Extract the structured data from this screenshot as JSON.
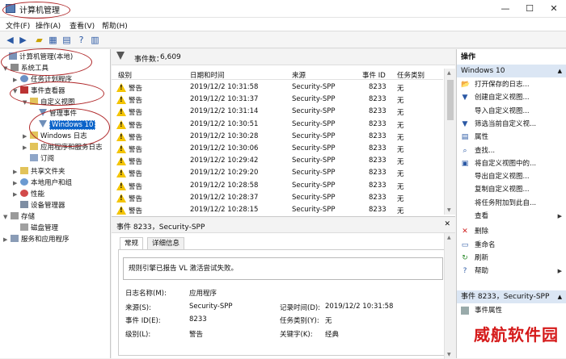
{
  "window": {
    "title": "计算机管理",
    "minimize": "—",
    "maximize": "☐",
    "close": "✕"
  },
  "menu": [
    "文件(F)",
    "操作(A)",
    "查看(V)",
    "帮助(H)"
  ],
  "tree": {
    "root": "计算机管理(本地)",
    "system_tools": "系统工具",
    "task_scheduler": "任务计划程序",
    "event_viewer": "事件查看器",
    "custom_views": "自定义视图",
    "admin_events": "管理事件",
    "windows10": "Windows 10",
    "windows_logs": "Windows 日志",
    "apps_logs": "应用程序和服务日志",
    "subscriptions": "订阅",
    "shared_folders": "共享文件夹",
    "local_users": "本地用户和组",
    "performance": "性能",
    "device_manager": "设备管理器",
    "storage": "存储",
    "disk_management": "磁盘管理",
    "services_apps": "服务和应用程序"
  },
  "events": {
    "header_label": "事件数：",
    "count": "6,609",
    "columns": [
      "级别",
      "日期和时间",
      "来源",
      "事件 ID",
      "任务类别"
    ],
    "rows": [
      {
        "level": "警告",
        "datetime": "2019/12/2 10:31:58",
        "source": "Security-SPP",
        "id": "8233",
        "category": "无"
      },
      {
        "level": "警告",
        "datetime": "2019/12/2 10:31:37",
        "source": "Security-SPP",
        "id": "8233",
        "category": "无"
      },
      {
        "level": "警告",
        "datetime": "2019/12/2 10:31:14",
        "source": "Security-SPP",
        "id": "8233",
        "category": "无"
      },
      {
        "level": "警告",
        "datetime": "2019/12/2 10:30:51",
        "source": "Security-SPP",
        "id": "8233",
        "category": "无"
      },
      {
        "level": "警告",
        "datetime": "2019/12/2 10:30:28",
        "source": "Security-SPP",
        "id": "8233",
        "category": "无"
      },
      {
        "level": "警告",
        "datetime": "2019/12/2 10:30:06",
        "source": "Security-SPP",
        "id": "8233",
        "category": "无"
      },
      {
        "level": "警告",
        "datetime": "2019/12/2 10:29:42",
        "source": "Security-SPP",
        "id": "8233",
        "category": "无"
      },
      {
        "level": "警告",
        "datetime": "2019/12/2 10:29:20",
        "source": "Security-SPP",
        "id": "8233",
        "category": "无"
      },
      {
        "level": "警告",
        "datetime": "2019/12/2 10:28:58",
        "source": "Security-SPP",
        "id": "8233",
        "category": "无"
      },
      {
        "level": "警告",
        "datetime": "2019/12/2 10:28:37",
        "source": "Security-SPP",
        "id": "8233",
        "category": "无"
      },
      {
        "level": "警告",
        "datetime": "2019/12/2 10:28:15",
        "source": "Security-SPP",
        "id": "8233",
        "category": "无"
      }
    ]
  },
  "detail": {
    "title": "事件 8233，Security-SPP",
    "close": "✕",
    "tab_general": "常规",
    "tab_details": "详细信息",
    "message": "规则引擎已报告 VL 激活尝试失败。",
    "log_name_label": "日志名称(M):",
    "log_name": "应用程序",
    "source_label": "来源(S):",
    "source": "Security-SPP",
    "logged_label": "记录时间(D):",
    "logged": "2019/12/2 10:31:58",
    "event_id_label": "事件 ID(E):",
    "event_id": "8233",
    "task_label": "任务类别(Y):",
    "task": "无",
    "level_label": "级别(L):",
    "level": "警告",
    "keywords_label": "关键字(K):",
    "keywords": "经典"
  },
  "actions": {
    "header": "操作",
    "section1": "Windows 10",
    "items": [
      {
        "label": "打开保存的日志...",
        "icon": "open-log-icon",
        "glyph": "📂"
      },
      {
        "label": "创建自定义视图...",
        "icon": "filter-icon",
        "glyph": "▼"
      },
      {
        "label": "导入自定义视图...",
        "icon": "import-icon",
        "glyph": ""
      },
      {
        "label": "筛选当前自定义视...",
        "icon": "filter-icon",
        "glyph": "▼"
      },
      {
        "label": "属性",
        "icon": "properties-icon",
        "glyph": "▤"
      },
      {
        "label": "查找...",
        "icon": "find-icon",
        "glyph": "⌕"
      },
      {
        "label": "将自定义视图中的...",
        "icon": "save-icon",
        "glyph": "▣"
      },
      {
        "label": "导出自定义视图...",
        "icon": "export-icon",
        "glyph": ""
      },
      {
        "label": "复制自定义视图...",
        "icon": "copy-icon",
        "glyph": ""
      },
      {
        "label": "将任务附加到此自...",
        "icon": "attach-icon",
        "glyph": ""
      },
      {
        "label": "查看",
        "icon": "view-icon",
        "glyph": "",
        "arrow": "▶"
      },
      {
        "label": "删除",
        "icon": "delete-icon",
        "glyph": "✕",
        "color": "#d02020"
      },
      {
        "label": "重命名",
        "icon": "rename-icon",
        "glyph": "▭"
      },
      {
        "label": "刷新",
        "icon": "refresh-icon",
        "glyph": "↻",
        "color": "#2a8a2a"
      },
      {
        "label": "帮助",
        "icon": "help-icon",
        "glyph": "?",
        "arrow": "▶",
        "color": "#2a58a4"
      }
    ],
    "section2": "事件 8233，Security-SPP",
    "last_item": "事件属性"
  },
  "colors": {
    "selection": "#0a63c9",
    "section_bg": "#dbe6f4",
    "warning": "#f4c400",
    "annotation": "#b0282a",
    "watermark": "#d51a1a"
  },
  "watermark": "威航软件园"
}
